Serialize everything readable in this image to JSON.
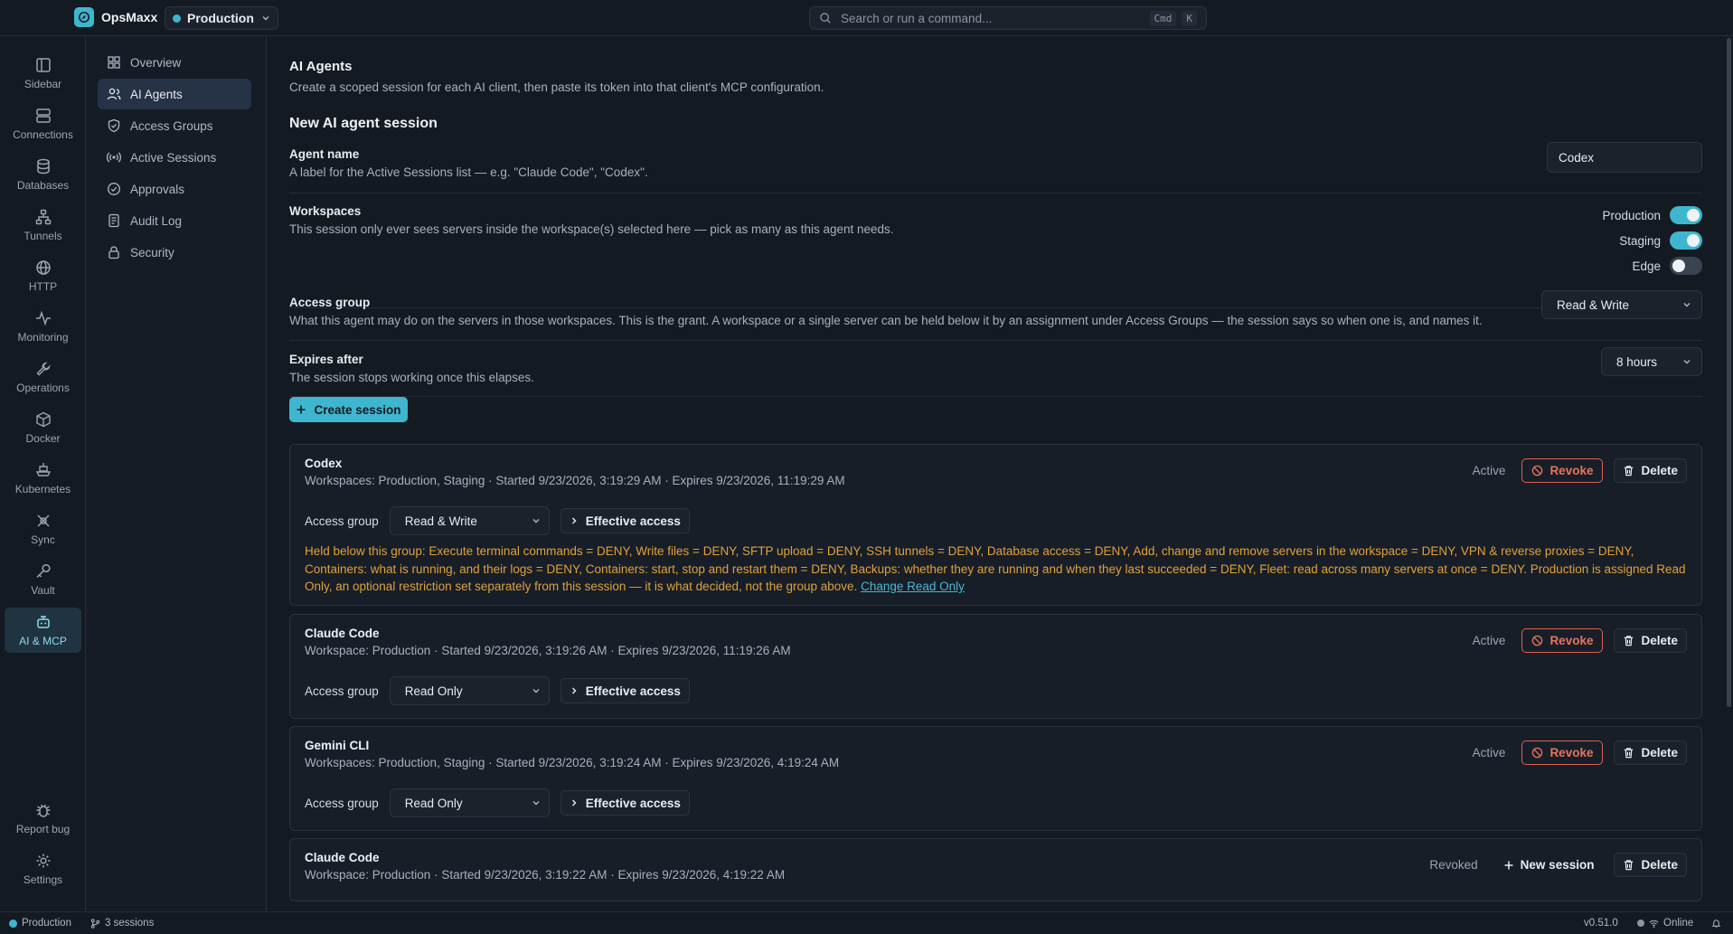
{
  "app": {
    "name": "OpsMaxx",
    "workspace": "Production",
    "search_placeholder": "Search or run a command...",
    "shortcut_keys": [
      "Cmd",
      "K"
    ]
  },
  "rail": {
    "items": [
      {
        "label": "Sidebar",
        "icon": "sidebar-icon"
      },
      {
        "label": "Connections",
        "icon": "server-icon"
      },
      {
        "label": "Databases",
        "icon": "database-icon"
      },
      {
        "label": "Tunnels",
        "icon": "network-icon"
      },
      {
        "label": "HTTP",
        "icon": "globe-icon"
      },
      {
        "label": "Monitoring",
        "icon": "activity-icon"
      },
      {
        "label": "Operations",
        "icon": "wrench-icon"
      },
      {
        "label": "Docker",
        "icon": "box-icon"
      },
      {
        "label": "Kubernetes",
        "icon": "ship-icon"
      },
      {
        "label": "Sync",
        "icon": "sync-icon"
      },
      {
        "label": "Vault",
        "icon": "key-icon"
      },
      {
        "label": "AI & MCP",
        "icon": "bot-icon",
        "active": true
      }
    ],
    "bottom": [
      {
        "label": "Report bug",
        "icon": "bug-icon"
      },
      {
        "label": "Settings",
        "icon": "gear-icon"
      }
    ]
  },
  "nav": {
    "items": [
      {
        "label": "Overview",
        "icon": "grid-icon"
      },
      {
        "label": "AI Agents",
        "icon": "users-icon",
        "active": true
      },
      {
        "label": "Access Groups",
        "icon": "shield-icon"
      },
      {
        "label": "Active Sessions",
        "icon": "broadcast-icon"
      },
      {
        "label": "Approvals",
        "icon": "check-circle-icon"
      },
      {
        "label": "Audit Log",
        "icon": "log-icon"
      },
      {
        "label": "Security",
        "icon": "lock-icon"
      }
    ]
  },
  "page": {
    "title": "AI Agents",
    "description": "Create a scoped session for each AI client, then paste its token into that client's MCP configuration.",
    "form_title": "New AI agent session",
    "agent_name": {
      "label": "Agent name",
      "help": "A label for the Active Sessions list — e.g. \"Claude Code\", \"Codex\".",
      "value": "Codex"
    },
    "workspaces": {
      "label": "Workspaces",
      "help": "This session only ever sees servers inside the workspace(s) selected here — pick as many as this agent needs.",
      "options": [
        {
          "label": "Production",
          "on": true
        },
        {
          "label": "Staging",
          "on": true
        },
        {
          "label": "Edge",
          "on": false
        }
      ]
    },
    "access_group": {
      "label": "Access group",
      "help": "What this agent may do on the servers in those workspaces. This is the grant. A workspace or a single server can be held below it by an assignment under Access Groups — the session says so when one is, and names it.",
      "value": "Read & Write"
    },
    "expires": {
      "label": "Expires after",
      "help": "The session stops working once this elapses.",
      "value": "8 hours"
    },
    "create_button": "Create session"
  },
  "sessions": [
    {
      "name": "Codex",
      "meta": "Workspaces: Production, Staging · Started 9/23/2026, 3:19:29 AM · Expires 9/23/2026, 11:19:29 AM",
      "status": "Active",
      "access_group_label": "Access group",
      "access_group": "Read & Write",
      "effective_label": "Effective access",
      "revoke_label": "Revoke",
      "delete_label": "Delete",
      "warning": "Held below this group: Execute terminal commands = DENY, Write files = DENY, SFTP upload = DENY, SSH tunnels = DENY, Database access = DENY, Add, change and remove servers in the workspace = DENY, VPN & reverse proxies = DENY, Containers: what is running, and their logs = DENY, Containers: start, stop and restart them = DENY, Backups: whether they are running and when they last succeeded = DENY, Fleet: read across many servers at once = DENY. Production is assigned Read Only, an optional restriction set separately from this session — it is what decided, not the group above.",
      "warning_link": "Change Read Only"
    },
    {
      "name": "Claude Code",
      "meta": "Workspace: Production · Started 9/23/2026, 3:19:26 AM · Expires 9/23/2026, 11:19:26 AM",
      "status": "Active",
      "access_group_label": "Access group",
      "access_group": "Read Only",
      "effective_label": "Effective access",
      "revoke_label": "Revoke",
      "delete_label": "Delete"
    },
    {
      "name": "Gemini CLI",
      "meta": "Workspaces: Production, Staging · Started 9/23/2026, 3:19:24 AM · Expires 9/23/2026, 4:19:24 AM",
      "status": "Active",
      "access_group_label": "Access group",
      "access_group": "Read Only",
      "effective_label": "Effective access",
      "revoke_label": "Revoke",
      "delete_label": "Delete"
    },
    {
      "name": "Claude Code",
      "meta": "Workspace: Production · Started 9/23/2026, 3:19:22 AM · Expires 9/23/2026, 4:19:22 AM",
      "status": "Revoked",
      "new_session_label": "New session",
      "delete_label": "Delete"
    }
  ],
  "footer": {
    "workspace": "Production",
    "sessions": "3 sessions",
    "version": "v0.51.0",
    "connection": "Online"
  },
  "colors": {
    "accent": "#3fb6cf",
    "danger": "#e8735f",
    "warning": "#e0a13a",
    "online": "#41c37a"
  }
}
